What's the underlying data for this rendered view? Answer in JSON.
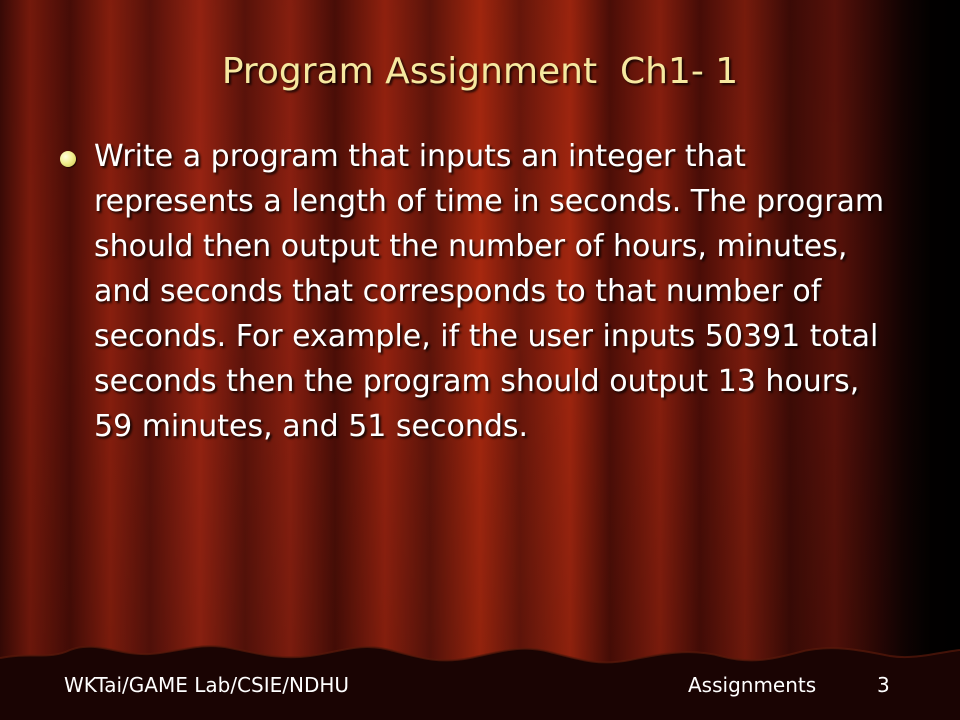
{
  "slide": {
    "title": "Program Assignment  Ch1- 1",
    "bullet": "Write a program that inputs an integer that represents a length of time in seconds.  The program should then output the number of hours, minutes, and seconds that corresponds to that number of seconds.  For example, if the user inputs 50391 total seconds then the program should output 13 hours, 59 minutes, and 51 seconds."
  },
  "footer": {
    "left": "WKTai/GAME Lab/CSIE/NDHU",
    "center": "Assignments",
    "page_number": "3"
  },
  "colors": {
    "title": "#f6e8a0",
    "bullet_dot": "#f2ef90",
    "body_text": "#ffffff",
    "curtain_red": "#8a1f0e",
    "fringe": "#1a0403"
  }
}
